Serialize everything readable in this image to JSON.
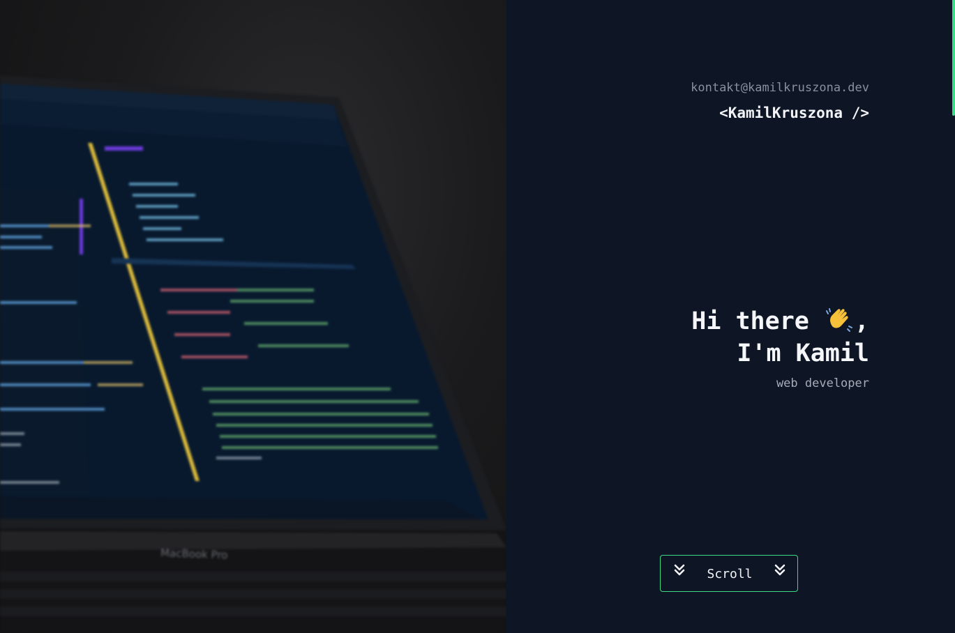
{
  "hero": {
    "image_alt": "Laptop screen with code editor",
    "laptop_brand": "MacBook Pro"
  },
  "header": {
    "email": "kontakt@kamilkruszona.dev",
    "logo": "<KamilKruszona />"
  },
  "intro": {
    "greeting": "Hi there",
    "greeting_suffix": ",",
    "wave_icon": "waving-hand-icon",
    "name_line": "I'm Kamil",
    "role": "web developer"
  },
  "scroll_button": {
    "label": "Scroll",
    "icon": "double-chevron-down-icon"
  },
  "colors": {
    "background": "#0e1524",
    "accent": "#3ddc84",
    "text": "#f2f4f8",
    "muted": "#8a919e"
  }
}
